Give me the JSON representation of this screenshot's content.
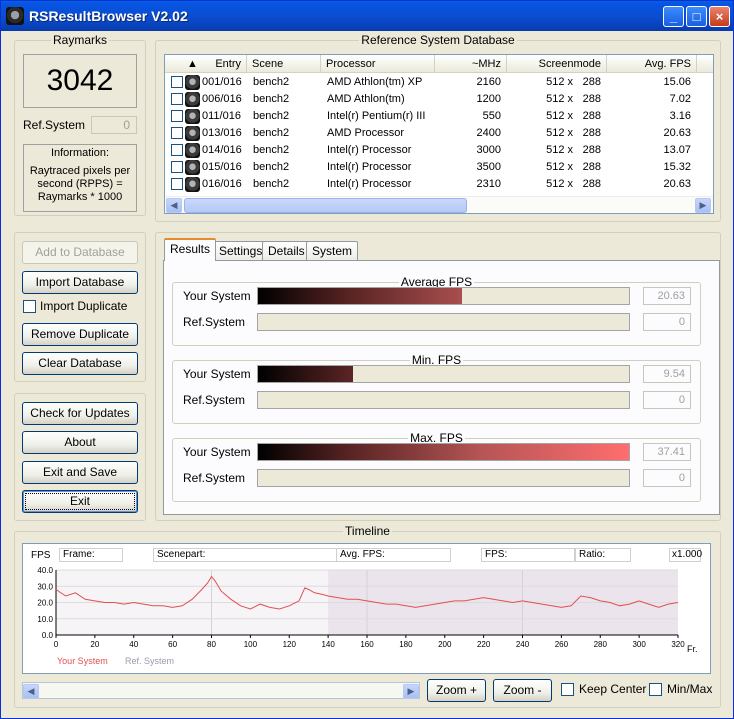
{
  "window": {
    "title": "RSResultBrowser V2.02",
    "min_label": "_",
    "max_label": "□",
    "close_label": "×"
  },
  "raymarks": {
    "group_title": "Raymarks",
    "score": "3042",
    "ref_label": "Ref.System",
    "ref_value": "0",
    "info_title": "Information:",
    "info_text": "Raytraced pixels per second (RPPS) = Raymarks * 1000"
  },
  "db_buttons": {
    "add": "Add to Database",
    "import": "Import Database",
    "import_duplicate": "Import Duplicate",
    "remove_duplicate": "Remove Duplicate",
    "clear": "Clear Database"
  },
  "app_buttons": {
    "check_updates": "Check for Updates",
    "about": "About",
    "exit_save": "Exit and Save",
    "exit": "Exit"
  },
  "reference": {
    "group_title": "Reference System Database",
    "sort_arrow": "▲",
    "columns": [
      "Entry",
      "Scene",
      "Processor",
      "~MHz",
      "Screenmode",
      "Avg. FPS"
    ],
    "rows": [
      {
        "entry": "001/016",
        "scene": "bench2",
        "processor": "AMD Athlon(tm) XP",
        "mhz": "2160",
        "mode_w": "512 x",
        "mode_h": "288",
        "fps": "15.06"
      },
      {
        "entry": "006/016",
        "scene": "bench2",
        "processor": "AMD Athlon(tm)",
        "mhz": "1200",
        "mode_w": "512 x",
        "mode_h": "288",
        "fps": "7.02"
      },
      {
        "entry": "011/016",
        "scene": "bench2",
        "processor": "Intel(r) Pentium(r) III",
        "mhz": "550",
        "mode_w": "512 x",
        "mode_h": "288",
        "fps": "3.16"
      },
      {
        "entry": "013/016",
        "scene": "bench2",
        "processor": "AMD Processor",
        "mhz": "2400",
        "mode_w": "512 x",
        "mode_h": "288",
        "fps": "20.63"
      },
      {
        "entry": "014/016",
        "scene": "bench2",
        "processor": "Intel(r) Processor",
        "mhz": "3000",
        "mode_w": "512 x",
        "mode_h": "288",
        "fps": "13.07"
      },
      {
        "entry": "015/016",
        "scene": "bench2",
        "processor": "Intel(r) Processor",
        "mhz": "3500",
        "mode_w": "512 x",
        "mode_h": "288",
        "fps": "15.32"
      },
      {
        "entry": "016/016",
        "scene": "bench2",
        "processor": "Intel(r) Processor",
        "mhz": "2310",
        "mode_w": "512 x",
        "mode_h": "288",
        "fps": "20.63"
      }
    ]
  },
  "tabs": [
    "Results",
    "Settings",
    "Details",
    "System"
  ],
  "results": {
    "your_label": "Your System",
    "ref_label": "Ref.System",
    "groups": [
      {
        "title": "Average FPS",
        "your_value": "20.63",
        "ref_value": "0",
        "your_fraction": 0.55
      },
      {
        "title": "Min. FPS",
        "your_value": "9.54",
        "ref_value": "0",
        "your_fraction": 0.255
      },
      {
        "title": "Max. FPS",
        "your_value": "37.41",
        "ref_value": "0",
        "your_fraction": 1.0
      }
    ]
  },
  "timeline": {
    "group_title": "Timeline",
    "fields": {
      "fps_axis": "FPS",
      "frame": "Frame:",
      "scenepart": "Scenepart:",
      "avg_fps": "Avg. FPS:",
      "fps": "FPS:",
      "ratio": "Ratio:",
      "zoom": "x1.000"
    },
    "x_unit": "Fr.",
    "legend_your": "Your System",
    "legend_ref": "Ref. System",
    "zoom_in": "Zoom +",
    "zoom_out": "Zoom -",
    "keep_center": "Keep Center",
    "min_max": "Min/Max"
  },
  "colors": {
    "series": "#e05050",
    "highlight": "#ece4ec"
  },
  "chart_data": {
    "type": "line",
    "title": "",
    "xlabel": "Fr.",
    "ylabel": "FPS",
    "xlim": [
      0,
      320
    ],
    "ylim": [
      0,
      40
    ],
    "x_ticks": [
      0,
      20,
      40,
      60,
      80,
      100,
      120,
      140,
      160,
      180,
      200,
      220,
      240,
      260,
      280,
      300,
      320
    ],
    "y_ticks": [
      "0.0",
      "10.0",
      "20.0",
      "30.0",
      "40.0"
    ],
    "highlight_range": [
      140,
      320
    ],
    "series": [
      {
        "name": "Your System",
        "x": [
          0,
          5,
          10,
          15,
          20,
          25,
          30,
          35,
          40,
          45,
          50,
          55,
          60,
          65,
          70,
          75,
          78,
          80,
          82,
          85,
          90,
          95,
          100,
          105,
          110,
          115,
          120,
          125,
          128,
          130,
          133,
          137,
          140,
          145,
          150,
          155,
          160,
          165,
          170,
          175,
          180,
          185,
          190,
          195,
          200,
          205,
          210,
          215,
          220,
          225,
          230,
          235,
          240,
          245,
          250,
          255,
          260,
          265,
          270,
          275,
          280,
          285,
          290,
          295,
          300,
          305,
          310,
          315,
          320
        ],
        "y": [
          28,
          24,
          26,
          22,
          21,
          20,
          20,
          19,
          20,
          19,
          18,
          18,
          17,
          18,
          22,
          28,
          32,
          36,
          33,
          27,
          22,
          18,
          16,
          19,
          17,
          16,
          18,
          21,
          29,
          28,
          26,
          25,
          24,
          23,
          22,
          22,
          21,
          20,
          19,
          19,
          18,
          17,
          18,
          19,
          20,
          21,
          21,
          22,
          23,
          22,
          21,
          20,
          21,
          20,
          19,
          18,
          17,
          18,
          24,
          23,
          21,
          20,
          18,
          19,
          21,
          19,
          17,
          19,
          20
        ]
      },
      {
        "name": "Ref. System",
        "x": [],
        "y": []
      }
    ]
  }
}
